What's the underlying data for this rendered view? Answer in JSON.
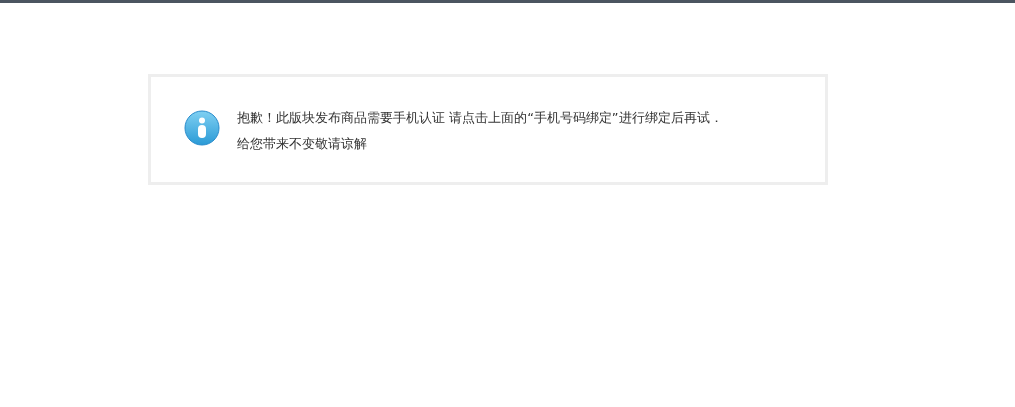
{
  "message": {
    "lines": [
      "抱歉！此版块发布商品需要手机认证 请点击上面的“手机号码绑定”进行绑定后再试．",
      "给您带来不变敬请谅解"
    ]
  }
}
